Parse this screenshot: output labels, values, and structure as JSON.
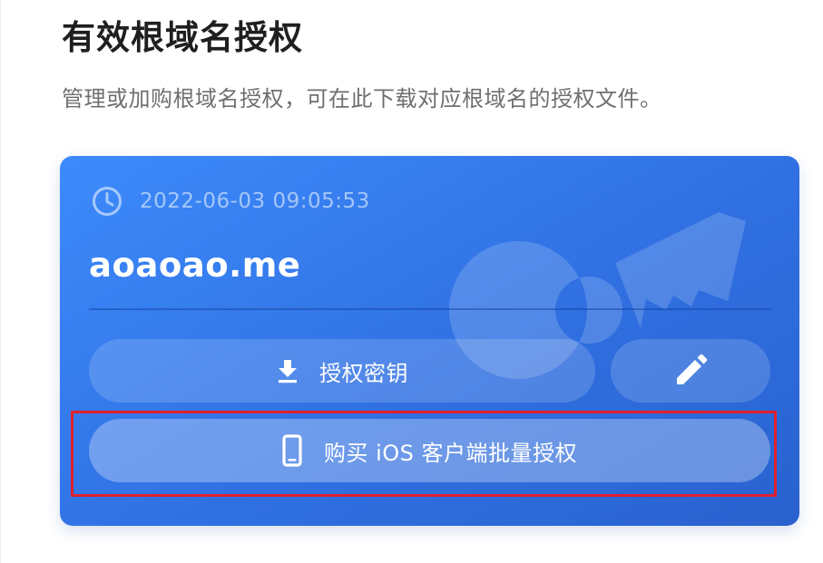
{
  "header": {
    "title": "有效根域名授权",
    "subtitle": "管理或加购根域名授权，可在此下载对应根域名的授权文件。"
  },
  "license_card": {
    "timestamp": "2022-06-03 09:05:53",
    "domain": "aoaoao.me",
    "buttons": {
      "license_key_label": "授权密钥",
      "buy_ios_batch_label": "购买 iOS 客户端批量授权"
    },
    "icons": {
      "time": "clock-icon",
      "license_key": "download-icon",
      "edit": "pencil-icon",
      "buy_ios": "smartphone-icon",
      "watermark": "key-icon"
    }
  },
  "colors": {
    "card_gradient_start": "#3d8bfb",
    "card_gradient_end": "#2962cf",
    "title_text": "#1f1f1f",
    "subtitle_text": "#6f6f6f",
    "highlight_border": "#e0202e"
  }
}
